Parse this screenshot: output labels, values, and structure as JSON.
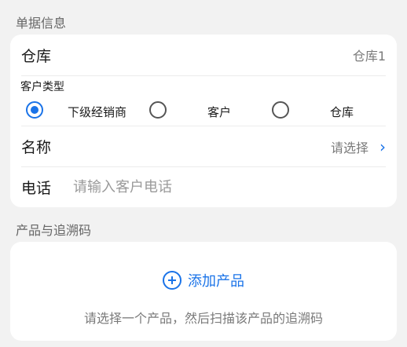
{
  "doc_info": {
    "section_title": "单据信息",
    "warehouse": {
      "label": "仓库",
      "value": "仓库1"
    },
    "customer_type": {
      "label": "客户类型",
      "options": [
        "下级经销商",
        "客户",
        "仓库"
      ],
      "selected": "下级经销商"
    },
    "name": {
      "label": "名称",
      "placeholder": "请选择"
    },
    "phone": {
      "label": "电话",
      "placeholder": "请输入客户电话"
    }
  },
  "products": {
    "section_title": "产品与追溯码",
    "add_label": "添加产品",
    "hint": "请选择一个产品，然后扫描该产品的追溯码"
  },
  "colors": {
    "accent": "#1a73e8"
  }
}
